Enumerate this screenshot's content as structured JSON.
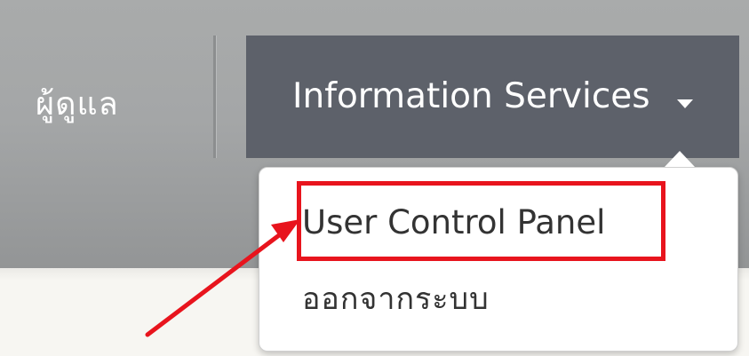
{
  "navbar": {
    "admin_label": "ผู้ดูแล",
    "info_services_label": "Information Services",
    "caret_icon": "caret-down-icon"
  },
  "dropdown": {
    "items": [
      {
        "label": "User Control Panel"
      },
      {
        "label": "ออกจากระบบ"
      }
    ]
  },
  "annotation": {
    "highlight_color": "#e8141d",
    "arrow_color": "#e8141d"
  },
  "colors": {
    "navbar_bg": "#a4a6a7",
    "active_tab_bg": "#5d616a",
    "menu_bg": "#ffffff",
    "menu_text": "#333333",
    "page_bg": "#f7f6f2"
  }
}
